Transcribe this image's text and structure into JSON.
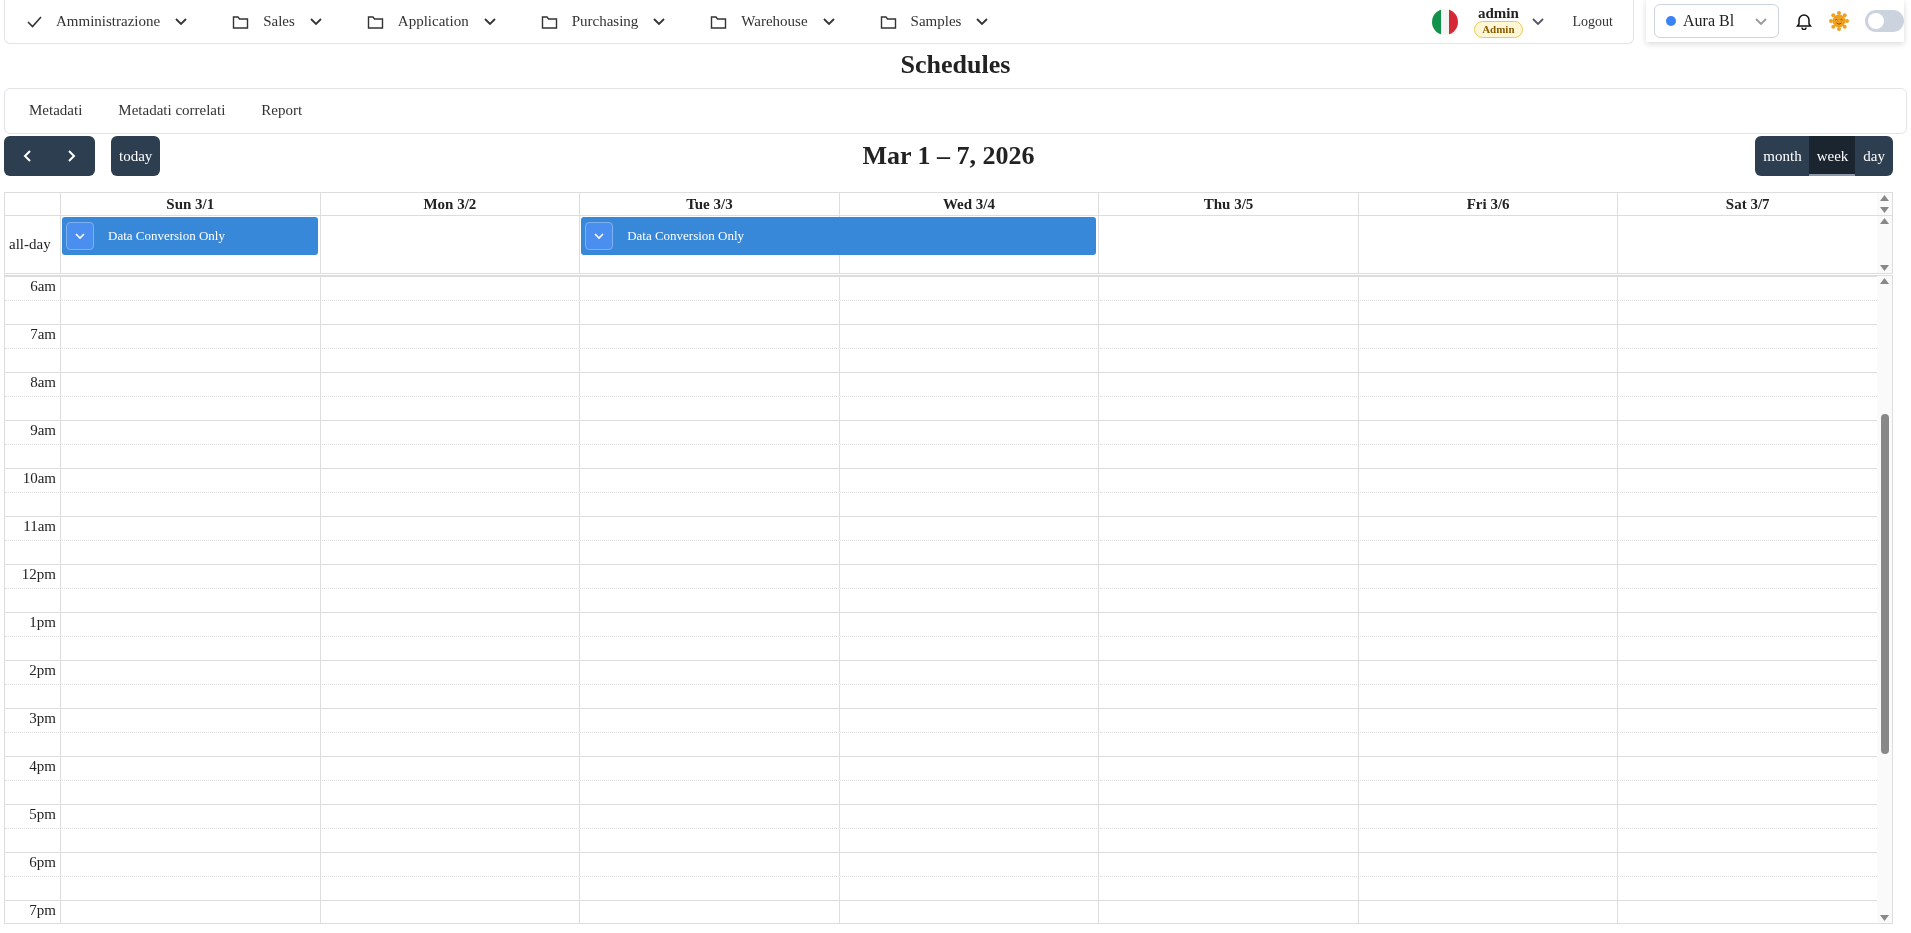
{
  "navbar": {
    "menus": [
      {
        "label": "Amministrazione",
        "selected": true
      },
      {
        "label": "Sales",
        "selected": false
      },
      {
        "label": "Application",
        "selected": false
      },
      {
        "label": "Purchasing",
        "selected": false
      },
      {
        "label": "Warehouse",
        "selected": false
      },
      {
        "label": "Samples",
        "selected": false
      }
    ],
    "user": {
      "name": "admin",
      "role": "Admin"
    },
    "logout": "Logout",
    "theme_select": {
      "value": "Aura Bl"
    },
    "dark_mode": {
      "on": false
    }
  },
  "page_title": "Schedules",
  "tabs": [
    {
      "label": "Metadati",
      "selected": false
    },
    {
      "label": "Metadati correlati",
      "selected": false
    },
    {
      "label": "Report",
      "selected": false
    }
  ],
  "calendar": {
    "today_button": "today",
    "title": "Mar 1 – 7, 2026",
    "views": [
      {
        "label": "month",
        "selected": false
      },
      {
        "label": "week",
        "selected": true
      },
      {
        "label": "day",
        "selected": false
      }
    ],
    "days": [
      "Sun 3/1",
      "Mon 3/2",
      "Tue 3/3",
      "Wed 3/4",
      "Thu 3/5",
      "Fri 3/6",
      "Sat 3/7"
    ],
    "all_day_label": "all-day",
    "all_day": [
      {
        "kind": "event",
        "title": "Data Conversion Only"
      },
      {
        "kind": "empty"
      },
      {
        "kind": "event",
        "title": "Data Conversion Only"
      },
      {
        "kind": "continuation"
      },
      {
        "kind": "empty"
      },
      {
        "kind": "empty"
      },
      {
        "kind": "empty"
      }
    ],
    "times": [
      "6am",
      "7am",
      "8am",
      "9am",
      "10am",
      "11am",
      "12pm",
      "1pm",
      "2pm",
      "3pm",
      "4pm",
      "5pm",
      "6pm",
      "7pm"
    ]
  }
}
